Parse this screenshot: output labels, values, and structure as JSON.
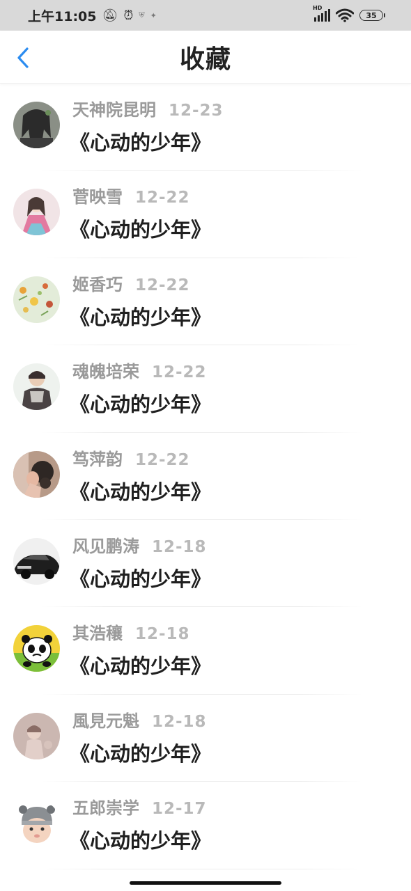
{
  "status_bar": {
    "time": "上午11:05",
    "icons": [
      "bell-off-icon",
      "alarm-icon",
      "shield-icon",
      "feather-icon"
    ],
    "network": "HD",
    "battery": "35"
  },
  "header": {
    "title": "收藏",
    "back_icon": "chevron-left-icon",
    "accent": "#2b8cf0"
  },
  "favorites": [
    {
      "name": "天神院昆明",
      "date": "12-23",
      "title": "《心动的少年》"
    },
    {
      "name": "菅映雪",
      "date": "12-22",
      "title": "《心动的少年》"
    },
    {
      "name": "姬香巧",
      "date": "12-22",
      "title": "《心动的少年》"
    },
    {
      "name": "魂魄培荣",
      "date": "12-22",
      "title": "《心动的少年》"
    },
    {
      "name": "笃萍韵",
      "date": "12-22",
      "title": "《心动的少年》"
    },
    {
      "name": "风见鹏涛",
      "date": "12-18",
      "title": "《心动的少年》"
    },
    {
      "name": "其浩穰",
      "date": "12-18",
      "title": "《心动的少年》"
    },
    {
      "name": "風見元魁",
      "date": "12-18",
      "title": "《心动的少年》"
    },
    {
      "name": "五郎崇学",
      "date": "12-17",
      "title": "《心动的少年》"
    }
  ]
}
